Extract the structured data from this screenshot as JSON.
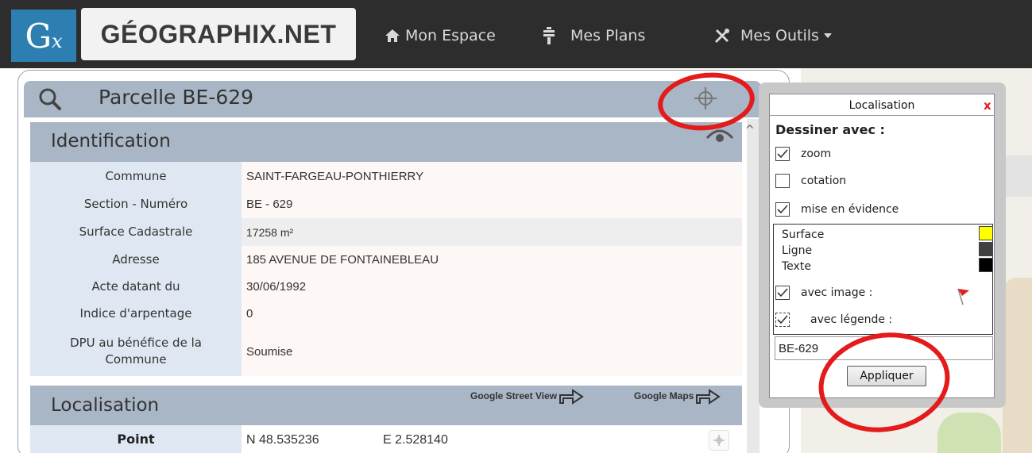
{
  "app": {
    "logo_mark": "Gx",
    "logo_mark_g": "G",
    "logo_mark_x": "x",
    "logo_text": "GÉOGRAPHIX.NET"
  },
  "nav": {
    "items": [
      {
        "label": "Mon Espace",
        "icon": "home-icon"
      },
      {
        "label": "Mes Plans",
        "icon": "plan-icon"
      },
      {
        "label": "Mes Outils",
        "icon": "tools-icon"
      }
    ]
  },
  "parcelle": {
    "title": "Parcelle BE-629"
  },
  "identification": {
    "title": "Identification",
    "rows": [
      {
        "label": "Commune",
        "value": "SAINT-FARGEAU-PONTHIERRY"
      },
      {
        "label": "Section - Numéro",
        "value": "BE - 629"
      },
      {
        "label": "Surface Cadastrale",
        "value": "17258 m²"
      },
      {
        "label": "Adresse",
        "value": "185 AVENUE DE FONTAINEBLEAU"
      },
      {
        "label": "Acte datant du",
        "value": "30/06/1992"
      },
      {
        "label": "Indice d'arpentage",
        "value": "0"
      },
      {
        "label": "DPU au bénéfice de la Commune",
        "value": "Soumise"
      }
    ]
  },
  "localisation_section": {
    "title": "Localisation",
    "street_view_label": "Google Street View",
    "maps_label": "Google Maps",
    "point_label": "Point",
    "point_n": "N 48.535236",
    "point_e": "E 2.528140"
  },
  "popup": {
    "title": "Localisation",
    "close": "x",
    "draw_with": "Dessiner avec :",
    "options": [
      {
        "label": "zoom",
        "checked": true
      },
      {
        "label": "cotation",
        "checked": false
      },
      {
        "label": "mise en évidence",
        "checked": true
      }
    ],
    "legend": [
      {
        "label": "Surface",
        "color": "#ffff00"
      },
      {
        "label": "Ligne",
        "color": "#404040"
      },
      {
        "label": "Texte",
        "color": "#000000"
      }
    ],
    "with_image": "avec image :",
    "with_legend": "avec légende :",
    "name_value": "BE-629",
    "apply": "Appliquer"
  },
  "colors": {
    "navbar": "#2d2d2d",
    "logo_blue": "#2c7fb0",
    "header_blue_gray": "#a9b6c6",
    "label_bg": "#dfe8f2",
    "annotation_red": "#e31b1b"
  }
}
